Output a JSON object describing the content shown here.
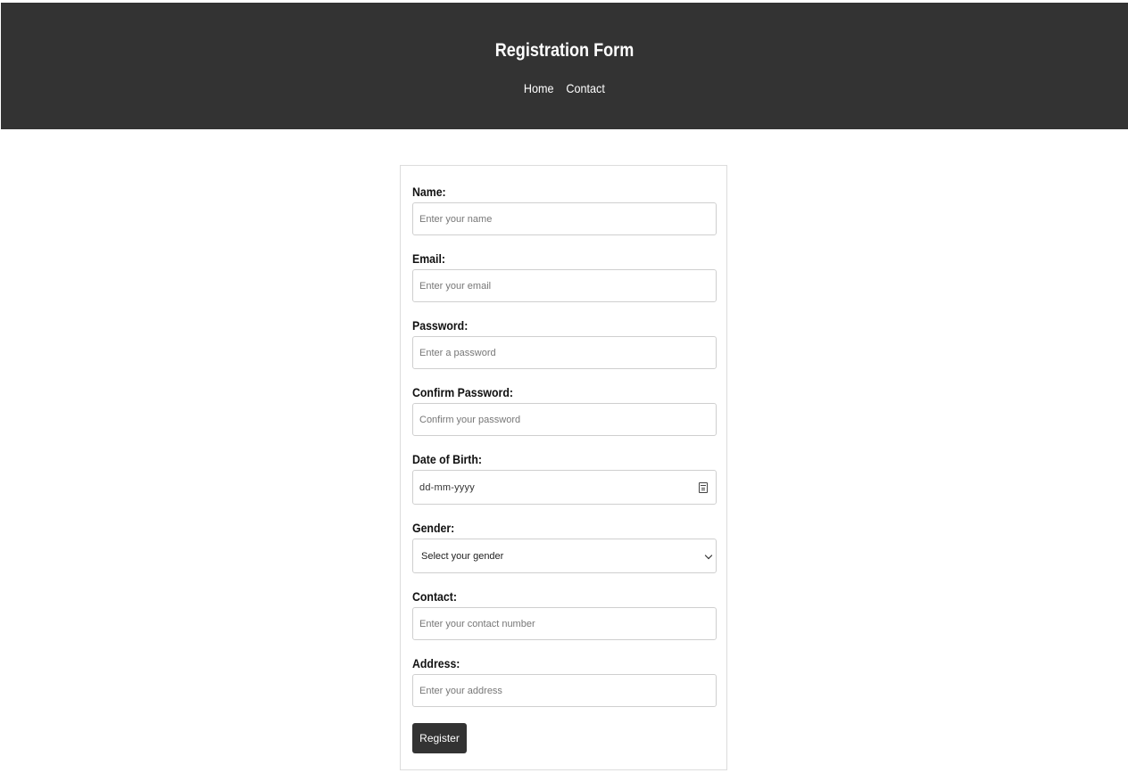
{
  "header": {
    "title": "Registration Form",
    "nav": [
      "Home",
      "Contact"
    ]
  },
  "form": {
    "fields": [
      {
        "label": "Name:",
        "placeholder": "Enter your name"
      },
      {
        "label": "Email:",
        "placeholder": "Enter your email"
      },
      {
        "label": "Password:",
        "placeholder": "Enter a password"
      },
      {
        "label": "Confirm Password:",
        "placeholder": "Confirm your password"
      },
      {
        "label": "Date of Birth:",
        "placeholder": "dd-mm-yyyy"
      },
      {
        "label": "Gender:",
        "placeholder": "Select your gender"
      },
      {
        "label": "Contact:",
        "placeholder": "Enter your contact number"
      },
      {
        "label": "Address:",
        "placeholder": "Enter your address"
      }
    ],
    "submit_label": "Register"
  },
  "colors": {
    "header_bg": "#333333",
    "button_bg": "#333333"
  },
  "icons": {
    "date": "calendar-icon",
    "select": "chevron-down-icon"
  }
}
